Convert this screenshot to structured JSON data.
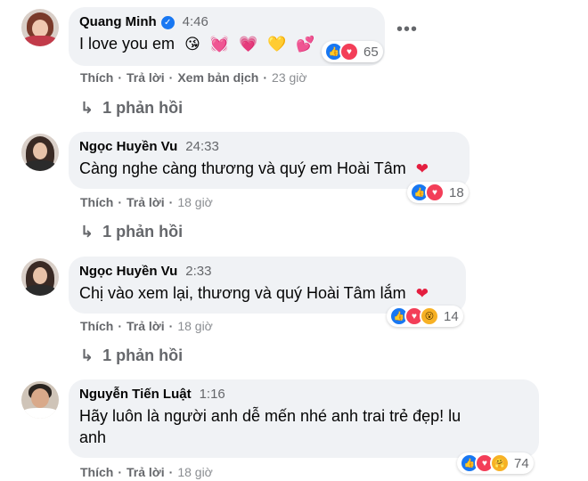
{
  "comments": [
    {
      "name": "Quang Minh",
      "verified": true,
      "time": "4:46",
      "text": "I love you em",
      "emojis": [
        "😘",
        "💓",
        "💗",
        "💛",
        "💕"
      ],
      "reaction_count": "65",
      "reaction_icons": [
        "like-icon",
        "love-icon"
      ],
      "actions": {
        "like": "Thích",
        "reply": "Trả lời",
        "translate": "Xem bản dịch",
        "ago": "23 giờ"
      },
      "replies_label": "1 phản hồi"
    },
    {
      "name": "Ngọc Huyền Vu",
      "time": "24:33",
      "text": "Càng nghe càng thương và quý em Hoài Tâm",
      "reaction_count": "18",
      "reaction_icons": [
        "like-icon",
        "love-icon"
      ],
      "actions": {
        "like": "Thích",
        "reply": "Trả lời",
        "ago": "18 giờ"
      },
      "replies_label": "1 phản hồi"
    },
    {
      "name": "Ngọc Huyền Vu",
      "time": "2:33",
      "text": "Chị vào xem lại, thương và quý Hoài Tâm lắm",
      "reaction_count": "14",
      "reaction_icons": [
        "like-icon",
        "love-icon",
        "wow-icon"
      ],
      "actions": {
        "like": "Thích",
        "reply": "Trả lời",
        "ago": "18 giờ"
      },
      "replies_label": "1 phản hồi"
    },
    {
      "name": "Nguyễn Tiến Luật",
      "time": "1:16",
      "text_line1": "Hãy luôn là người anh dễ mến nhé anh trai trẻ đẹp! lu",
      "text_line2": "anh",
      "reaction_count": "74",
      "reaction_icons": [
        "like-icon",
        "love-icon",
        "care-icon"
      ],
      "actions": {
        "like": "Thích",
        "reply": "Trả lời",
        "ago": "18 giờ"
      }
    }
  ],
  "icons": {
    "heart": "❤",
    "reply_arrow": "↳",
    "more": "•••",
    "verified": "✓"
  },
  "colors": {
    "accent": "#1877f2",
    "love": "#f33e58",
    "bubble": "#f0f2f5",
    "muted": "#65676b"
  }
}
